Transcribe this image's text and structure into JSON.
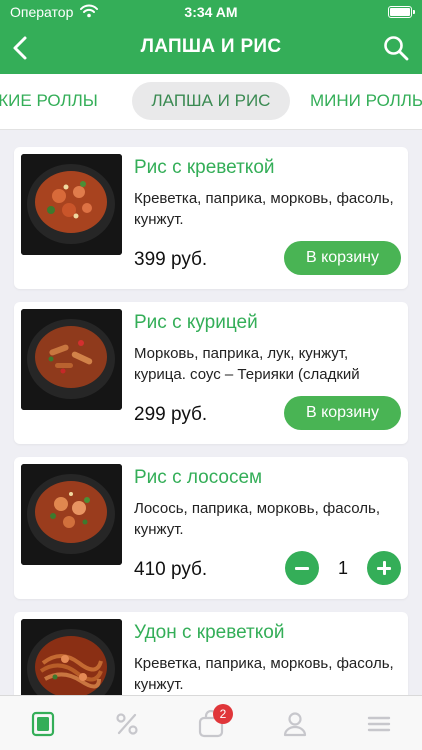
{
  "status_bar": {
    "carrier": "Оператор",
    "time": "3:34 AM"
  },
  "navbar": {
    "title": "ЛАПША И РИС"
  },
  "categories": {
    "left": "СКИЕ РОЛЛЫ",
    "active": "ЛАПША И РИС",
    "right": "МИНИ РОЛЛЫ"
  },
  "products": [
    {
      "name": "Рис с креветкой",
      "description": "Креветка, паприка, морковь, фасоль, кунжут.",
      "price": "399 руб.",
      "button": "В корзину"
    },
    {
      "name": "Рис с курицей",
      "description": "Морковь, паприка, лук, кунжут, курица. соус – Терияки (сладкий",
      "price": "299 руб.",
      "button": "В корзину"
    },
    {
      "name": "Рис с лососем",
      "description": "Лосось, паприка, морковь, фасоль, кунжут.",
      "price": "410 руб.",
      "quantity": "1"
    },
    {
      "name": "Удон с креветкой",
      "description": "Креветка, паприка, морковь, фасоль, кунжут."
    }
  ],
  "tabbar": {
    "cart_badge": "2"
  },
  "colors": {
    "brand_green": "#34ae58",
    "button_green": "#49b454",
    "badge_red": "#e0363a",
    "inactive_icon": "#c7c7cc"
  },
  "icons": {
    "tabbar": [
      "menu-icon",
      "percent-icon",
      "bag-icon",
      "profile-icon",
      "hamburger-icon"
    ],
    "navbar": [
      "back-chevron-icon",
      "search-icon"
    ]
  }
}
